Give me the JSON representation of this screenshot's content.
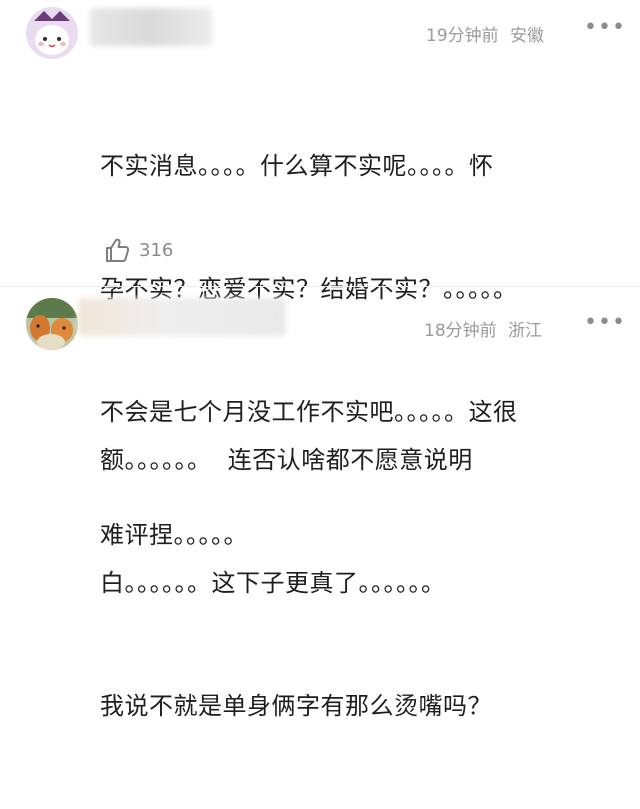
{
  "comments": [
    {
      "time": "19分钟前",
      "location": "安徽",
      "more_glyph": "•••",
      "lines": [
        "不实消息。。。。什么算不实呢。。。。怀",
        "孕不实？恋爱不实？结婚不实？。。。。。",
        "不会是七个月没工作不实吧。。。。。这很",
        "难评捏。。。。。"
      ],
      "likes": "316",
      "avatar_icon": "cartoon-avatar-icon"
    },
    {
      "time": "18分钟前",
      "location": "浙江",
      "more_glyph": "•••",
      "lines": [
        "额。。。。。。  连否认啥都不愿意说明",
        "白。。。。。。这下子更真了。。。。。。",
        "我说不就是单身俩字有那么烫嘴吗？"
      ],
      "avatar_icon": "photo-avatar-icon"
    }
  ]
}
